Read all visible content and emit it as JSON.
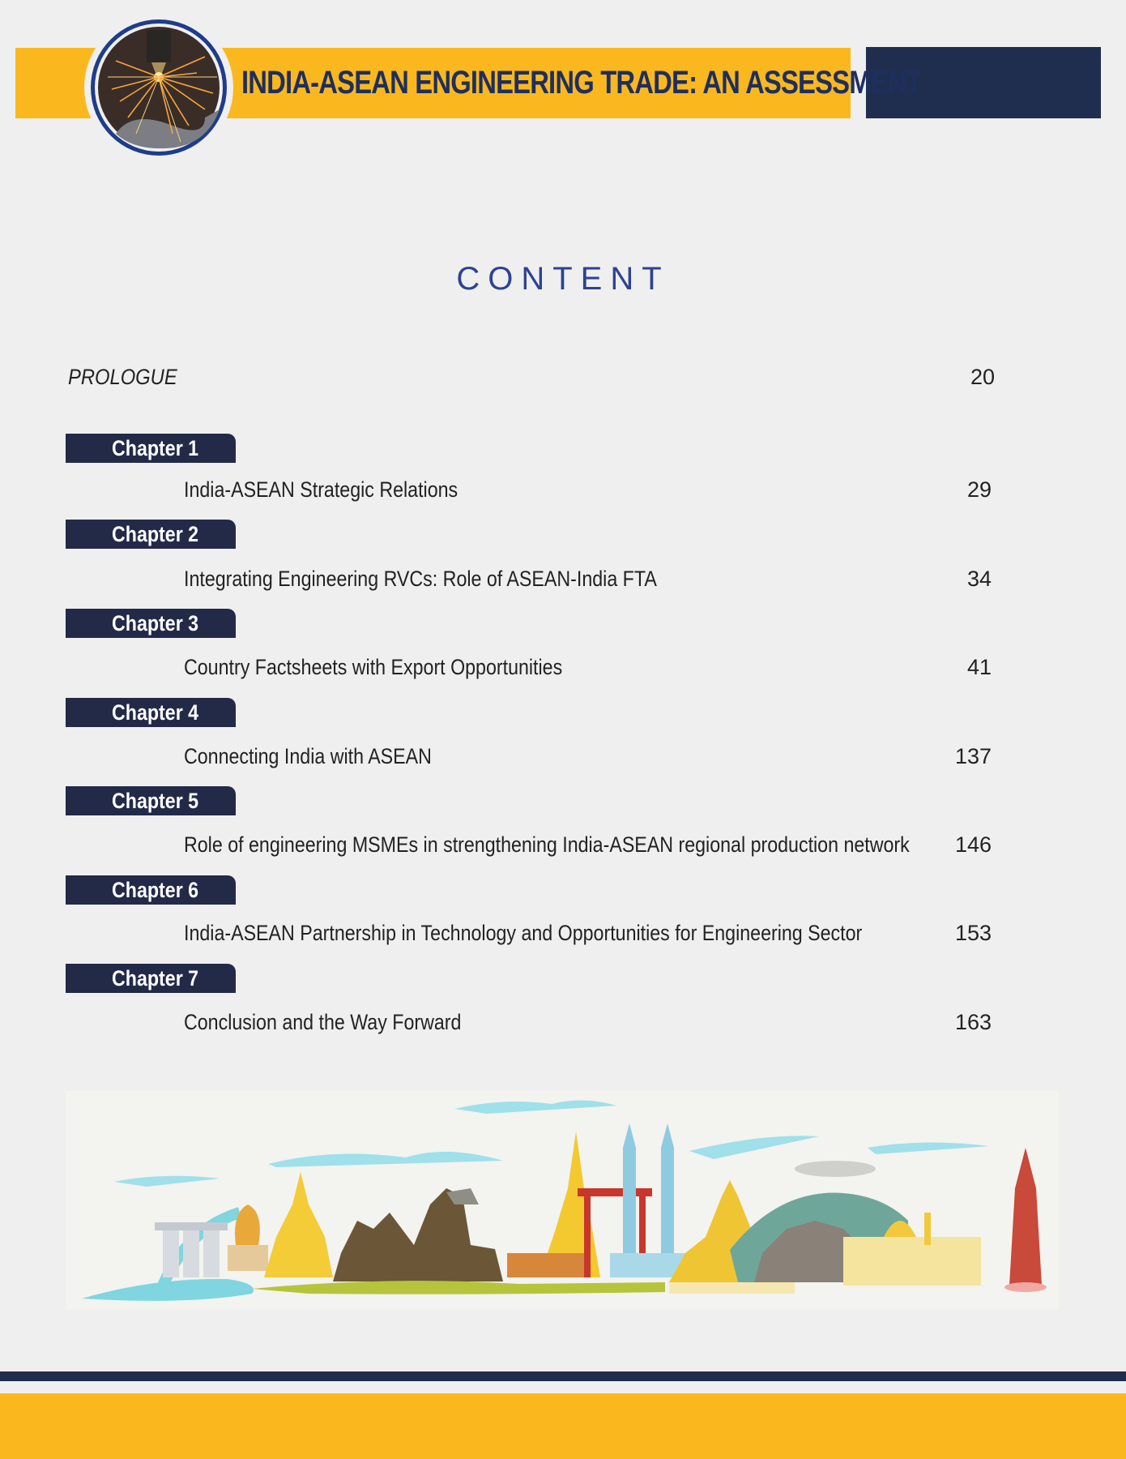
{
  "header": {
    "title": "INDIA-ASEAN ENGINEERING TRADE: AN ASSESSMENT"
  },
  "toc": {
    "heading": "CONTENT",
    "prologue": {
      "label": "PROLOGUE",
      "page": "20"
    },
    "chapters": [
      {
        "tab": "Chapter 1",
        "title": "India-ASEAN Strategic Relations",
        "page": "29"
      },
      {
        "tab": "Chapter 2",
        "title": "Integrating Engineering RVCs: Role of ASEAN-India FTA",
        "page": "34"
      },
      {
        "tab": "Chapter 3",
        "title": "Country Factsheets with Export Opportunities",
        "page": "41"
      },
      {
        "tab": "Chapter 4",
        "title": "Connecting India with ASEAN",
        "page": "137"
      },
      {
        "tab": "Chapter 5",
        "title": "Role of engineering MSMEs in strengthening India-ASEAN regional production network",
        "page": "146"
      },
      {
        "tab": "Chapter 6",
        "title": "India-ASEAN Partnership in Technology and Opportunities for Engineering Sector",
        "page": "153"
      },
      {
        "tab": "Chapter 7",
        "title": "Conclusion and the Way Forward",
        "page": "163"
      }
    ]
  },
  "colors": {
    "brand_yellow": "#fbb81e",
    "brand_navy": "#1f2e4e",
    "heading_blue": "#2d4294"
  },
  "icons": {
    "header_badge": "welding-sparks-icon",
    "skyline": "asean-landmarks-illustration"
  }
}
